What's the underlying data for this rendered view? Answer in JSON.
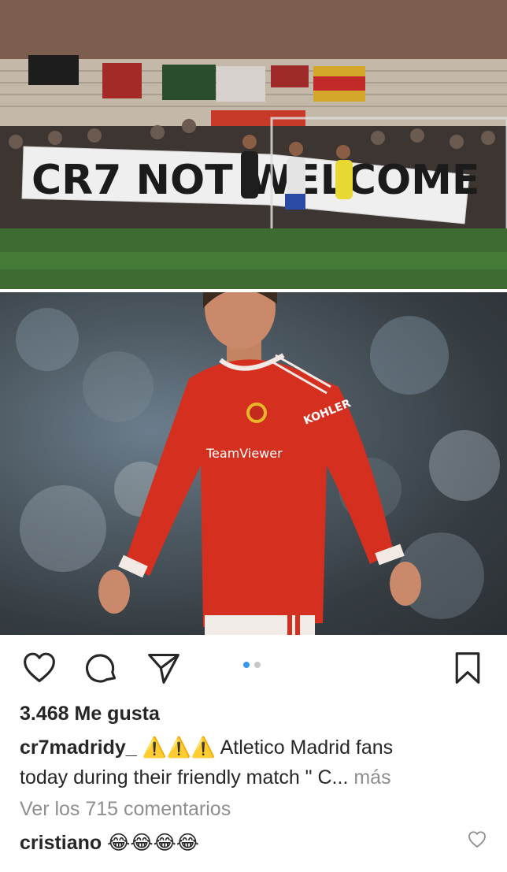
{
  "post": {
    "likes_text": "3.468 Me gusta",
    "caption_user": "cr7madridy_",
    "caption_emoji": "⚠️⚠️⚠️",
    "caption_line1": "Atletico Madrid fans",
    "caption_line2": "today during their friendly match \" C...",
    "caption_more": "más",
    "view_comments": "Ver los 715 comentarios",
    "comment_user": "cristiano",
    "comment_text": "😂😂😂😂",
    "carousel": {
      "total": 2,
      "current": 1
    }
  },
  "media": {
    "top_banner_text": "CR7 NOT WELCOME",
    "jersey_sponsor": "TeamViewer",
    "jersey_sleeve": "KOHLER"
  },
  "colors": {
    "accent_blue": "#3897f0",
    "text": "#262626",
    "muted": "#8e8e8e",
    "jersey_red": "#d5301f"
  },
  "icons": {
    "like": "heart-icon",
    "comment": "comment-bubble-icon",
    "share": "paper-plane-icon",
    "save": "bookmark-icon",
    "comment_like": "small-heart-icon"
  }
}
